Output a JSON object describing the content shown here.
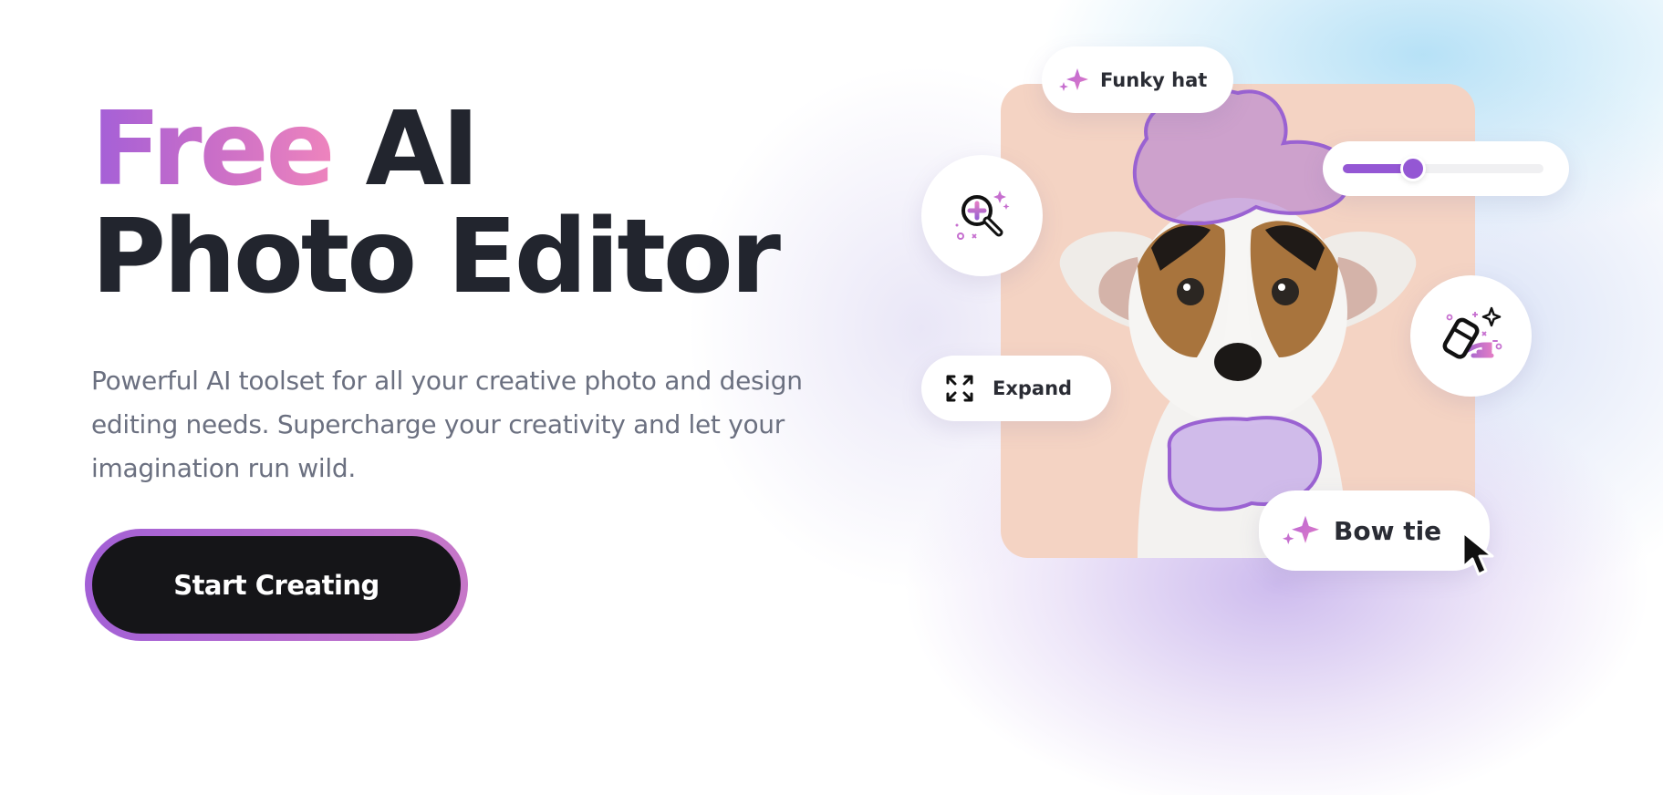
{
  "hero": {
    "title_highlight": "Free",
    "title_rest_line1": " AI",
    "title_line2": "Photo Editor",
    "subtitle": "Powerful AI toolset for all your creative photo and design editing needs. Supercharge your creativity and let your imagination run wild.",
    "cta_label": "Start Creating"
  },
  "showcase": {
    "chips": {
      "funky_hat": "Funky hat",
      "expand": "Expand",
      "bow_tie": "Bow tie"
    },
    "slider": {
      "value_percent": 35
    },
    "icons": {
      "zoom": "zoom-in-sparkle-icon",
      "eraser": "magic-eraser-icon",
      "expand": "expand-arrows-icon",
      "sparkle": "sparkle-icon",
      "cursor": "mouse-pointer-icon"
    }
  },
  "colors": {
    "accent_purple": "#9457d4",
    "accent_pink": "#ee84bd",
    "text_dark": "#22252e",
    "text_muted": "#6b7080",
    "button_bg": "#151518",
    "photo_bg": "#f4d3c3"
  }
}
